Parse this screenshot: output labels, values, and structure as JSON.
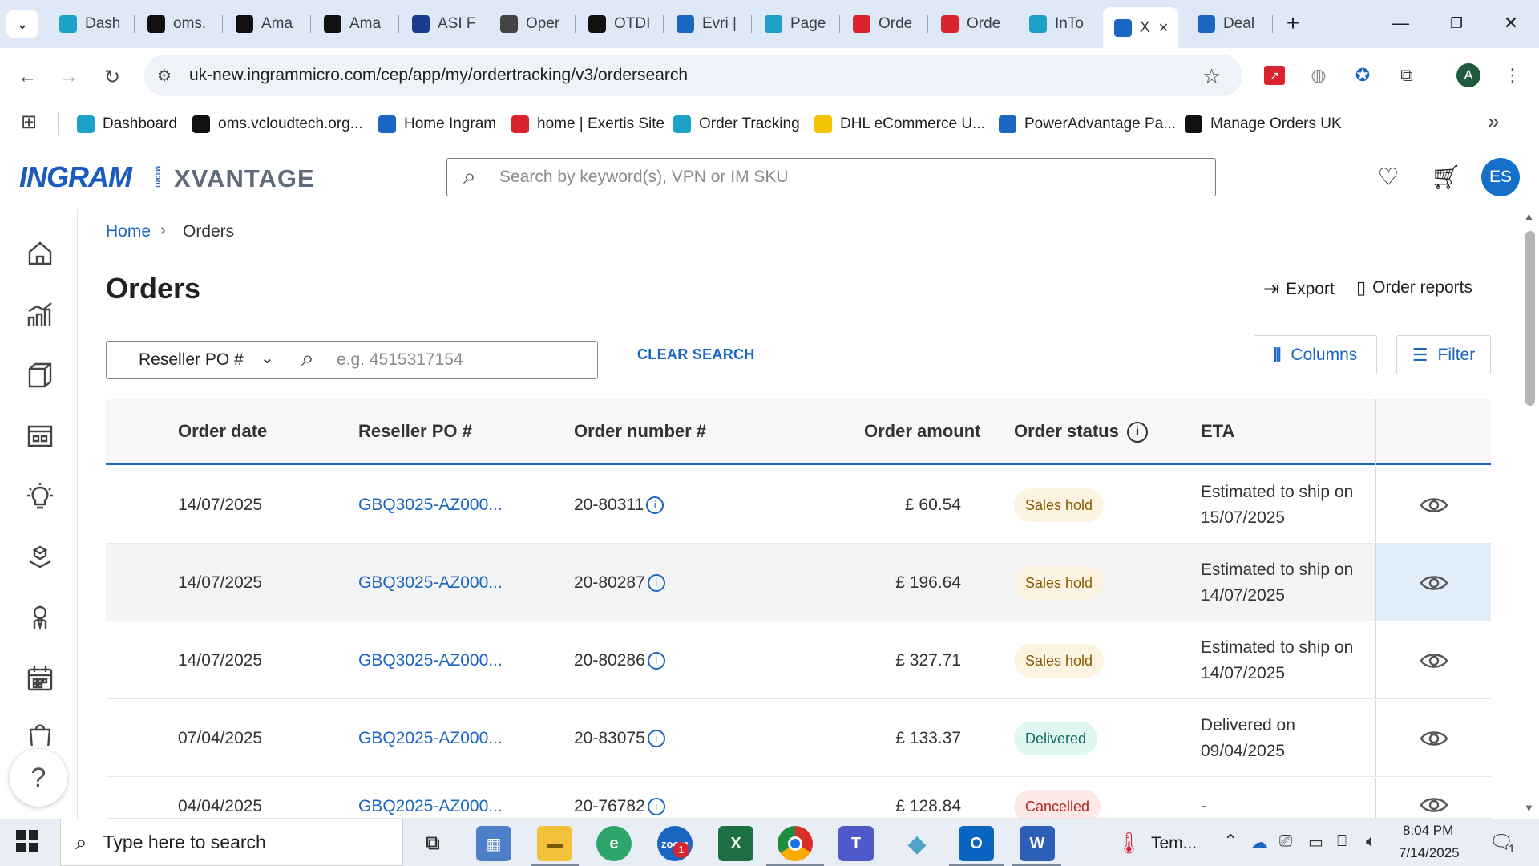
{
  "browser": {
    "tabs": [
      {
        "label": "Dash",
        "icon": "dashboard-icon",
        "color": "#1ea1c7"
      },
      {
        "label": "oms.",
        "icon": "oms-icon",
        "color": "#111111"
      },
      {
        "label": "Ama",
        "icon": "amazon-icon",
        "color": "#111111"
      },
      {
        "label": "Ama",
        "icon": "amazon-icon",
        "color": "#111111"
      },
      {
        "label": "ASI F",
        "icon": "arrow-icon",
        "color": "#1a3c8c"
      },
      {
        "label": "Oper",
        "icon": "openai-icon",
        "color": "#444444"
      },
      {
        "label": "OTDI",
        "icon": "openai-icon",
        "color": "#111111"
      },
      {
        "label": "Evri |",
        "icon": "evri-icon",
        "color": "#1a66c2"
      },
      {
        "label": "Page",
        "icon": "c-icon",
        "color": "#1ea1c7"
      },
      {
        "label": "Orde",
        "icon": "exertis-icon",
        "color": "#d9232e"
      },
      {
        "label": "Orde",
        "icon": "exertis-icon",
        "color": "#d9232e"
      },
      {
        "label": "InTo",
        "icon": "c-icon",
        "color": "#1ea1c7"
      },
      {
        "label": "X",
        "icon": "ingram-icon",
        "color": "#1a66c2"
      },
      {
        "label": "Deal",
        "icon": "doc-icon",
        "color": "#1a66c2"
      }
    ],
    "url": "uk-new.ingrammicro.com/cep/app/my/ordertracking/v3/ordersearch",
    "profile_initial": "A",
    "bookmarks": [
      {
        "label": "Dashboard",
        "icon": "dashboard-icon",
        "color": "#1ea1c7"
      },
      {
        "label": "oms.vcloudtech.org...",
        "icon": "oms-icon",
        "color": "#111111"
      },
      {
        "label": "Home Ingram",
        "icon": "ingram-icon",
        "color": "#1a66c2"
      },
      {
        "label": "home | Exertis Site",
        "icon": "exertis-icon",
        "color": "#d9232e"
      },
      {
        "label": "Order Tracking",
        "icon": "c-icon",
        "color": "#1ea1c7"
      },
      {
        "label": "DHL eCommerce U...",
        "icon": "dhl-icon",
        "color": "#f5c400"
      },
      {
        "label": "PowerAdvantage Pa...",
        "icon": "doc-icon",
        "color": "#1a66c2"
      },
      {
        "label": "Manage Orders UK",
        "icon": "amazon-icon",
        "color": "#111111"
      }
    ]
  },
  "app": {
    "logo_main": "INGRAM",
    "logo_micro": "MICRO",
    "logo_xvantage": "XVANTAGE",
    "search_placeholder": "Search by keyword(s), VPN or IM SKU",
    "user_initials": "ES"
  },
  "page": {
    "breadcrumb": {
      "home": "Home",
      "current": "Orders"
    },
    "title": "Orders",
    "export_label": "Export",
    "order_reports_label": "Order reports",
    "search_field_select": "Reseller PO #",
    "search_placeholder": "e.g. 4515317154",
    "clear_search_label": "CLEAR SEARCH",
    "columns_label": "Columns",
    "filter_label": "Filter"
  },
  "table": {
    "headers": {
      "order_date": "Order date",
      "reseller_po": "Reseller PO #",
      "order_number": "Order number #",
      "order_amount": "Order amount",
      "order_status": "Order status",
      "eta": "ETA"
    },
    "rows": [
      {
        "date": "14/07/2025",
        "po": "GBQ3025-AZ000...",
        "number": "20-80311",
        "amount": "£ 60.54",
        "status": "Sales hold",
        "eta1": "Estimated to ship on",
        "eta2": "15/07/2025"
      },
      {
        "date": "14/07/2025",
        "po": "GBQ3025-AZ000...",
        "number": "20-80287",
        "amount": "£ 196.64",
        "status": "Sales hold",
        "eta1": "Estimated to ship on",
        "eta2": "14/07/2025"
      },
      {
        "date": "14/07/2025",
        "po": "GBQ3025-AZ000...",
        "number": "20-80286",
        "amount": "£ 327.71",
        "status": "Sales hold",
        "eta1": "Estimated to ship on",
        "eta2": "14/07/2025"
      },
      {
        "date": "07/04/2025",
        "po": "GBQ2025-AZ000...",
        "number": "20-83075",
        "amount": "£ 133.37",
        "status": "Delivered",
        "eta1": "Delivered on",
        "eta2": "09/04/2025"
      },
      {
        "date": "04/04/2025",
        "po": "GBQ2025-AZ000...",
        "number": "20-76782",
        "amount": "£ 128.84",
        "status": "Cancelled",
        "eta1": "-",
        "eta2": ""
      }
    ],
    "status_colors": {
      "Sales hold": {
        "bg": "#fdf3e1",
        "fg": "#8a5a00"
      },
      "Delivered": {
        "bg": "#e0f6f1",
        "fg": "#0b6e57"
      },
      "Cancelled": {
        "bg": "#fde8e8",
        "fg": "#b3261e"
      }
    }
  },
  "taskbar": {
    "search_placeholder": "Type here to search",
    "weather": "Tem...",
    "time": "8:04 PM",
    "date": "7/14/2025",
    "notification_count": "1",
    "zoom_badge": "1"
  }
}
